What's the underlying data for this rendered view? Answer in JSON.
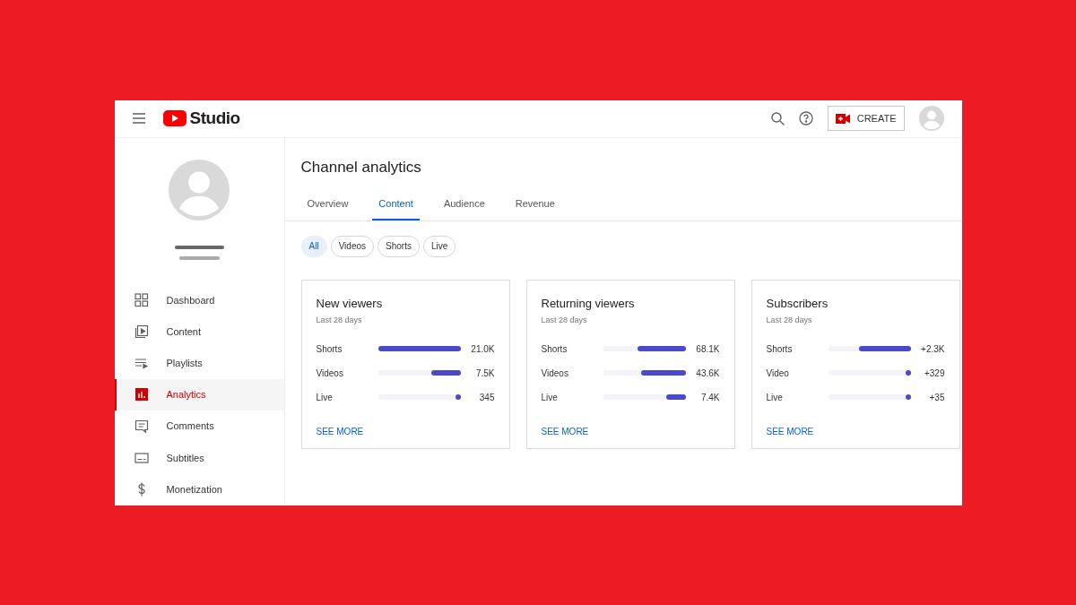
{
  "header": {
    "logo": "Studio",
    "create_button": "CREATE"
  },
  "sidebar": {
    "items": [
      {
        "label": "Dashboard",
        "kind": "dashboard",
        "selected": false
      },
      {
        "label": "Content",
        "kind": "content",
        "selected": false
      },
      {
        "label": "Playlists",
        "kind": "playlists",
        "selected": false
      },
      {
        "label": "Analytics",
        "kind": "analytics",
        "selected": true
      },
      {
        "label": "Comments",
        "kind": "comments",
        "selected": false
      },
      {
        "label": "Subtitles",
        "kind": "subtitles",
        "selected": false
      },
      {
        "label": "Monetization",
        "kind": "monetization",
        "selected": false
      }
    ]
  },
  "page_title": "Channel analytics",
  "tabs": [
    {
      "label": "Overview",
      "selected": false
    },
    {
      "label": "Content",
      "selected": true
    },
    {
      "label": "Audience",
      "selected": false
    },
    {
      "label": "Revenue",
      "selected": false
    }
  ],
  "filters": [
    {
      "label": "All",
      "selected": true
    },
    {
      "label": "Videos",
      "selected": false
    },
    {
      "label": "Shorts",
      "selected": false
    },
    {
      "label": "Live",
      "selected": false
    }
  ],
  "cards": [
    {
      "title": "New viewers",
      "period": "Last 28 days",
      "rows": [
        {
          "label": "Shorts",
          "level": 1,
          "value": "21.0K"
        },
        {
          "label": "Videos",
          "level": 0.35,
          "value": "7.5K"
        },
        {
          "label": "Live",
          "level": 0.06,
          "value": "345"
        }
      ],
      "link": "SEE MORE"
    },
    {
      "title": "Returning viewers",
      "period": "Last 28 days",
      "rows": [
        {
          "label": "Shorts",
          "level": 0.58,
          "value": "68.1K"
        },
        {
          "label": "Videos",
          "level": 0.54,
          "value": "43.6K"
        },
        {
          "label": "Live",
          "level": 0.23,
          "value": "7.4K"
        }
      ],
      "link": "SEE MORE"
    },
    {
      "title": "Subscribers",
      "period": "Last 28 days",
      "rows": [
        {
          "label": "Shorts",
          "level": 0.62,
          "value": "+2.3K"
        },
        {
          "label": "Video",
          "level": 0.06,
          "value": "+329"
        },
        {
          "label": "Live",
          "level": 0.06,
          "value": "+35"
        }
      ],
      "link": "SEE MORE"
    }
  ]
}
